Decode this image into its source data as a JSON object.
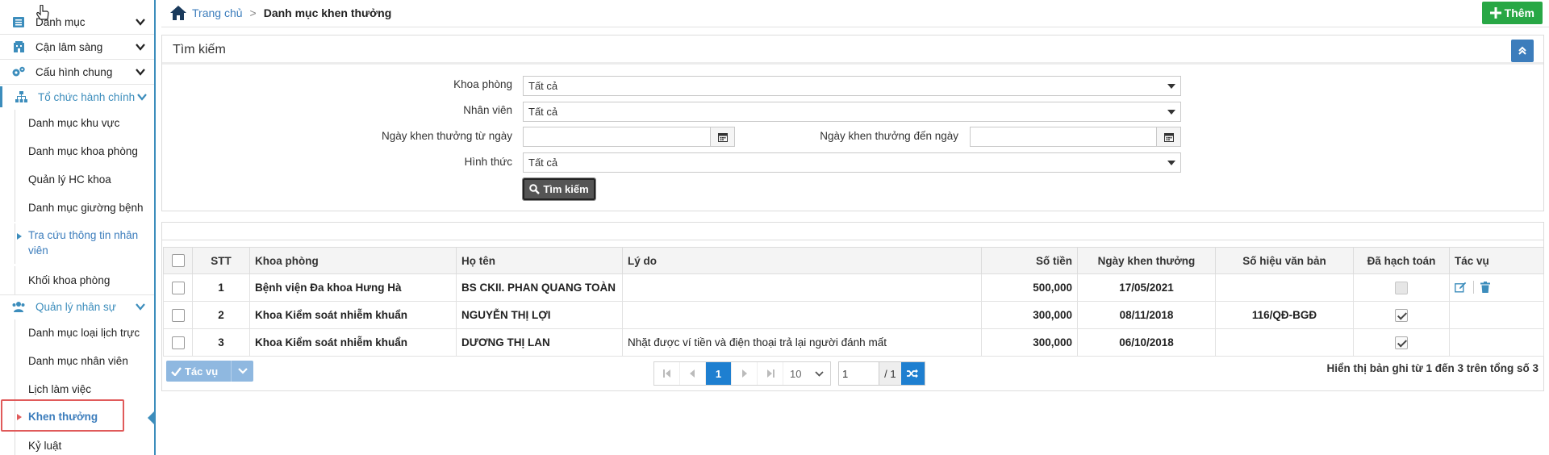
{
  "sidebar": {
    "items": [
      {
        "label": "Danh mục",
        "icon": "list-icon"
      },
      {
        "label": "Cận lâm sàng",
        "icon": "hospital-icon"
      },
      {
        "label": "Cấu hình chung",
        "icon": "gears-icon"
      },
      {
        "label": "Tổ chức hành chính",
        "icon": "org-chart-icon"
      }
    ],
    "org_sub": [
      "Danh mục khu vực",
      "Danh mục khoa phòng",
      "Quản lý HC khoa",
      "Danh mục giường bệnh",
      "Tra cứu thông tin nhân viên",
      "Khối khoa phòng"
    ],
    "hr_group": {
      "label": "Quản lý nhân sự",
      "icon": "users-icon"
    },
    "hr_sub": [
      "Danh mục loại lịch trực",
      "Danh mục nhân viên",
      "Lịch làm việc",
      "Khen thưởng",
      "Kỷ luật"
    ]
  },
  "header": {
    "home": "Trang chủ",
    "page": "Danh mục khen thưởng",
    "add_label": "Thêm"
  },
  "search": {
    "title": "Tìm kiếm",
    "dept_label": "Khoa phòng",
    "dept_value": "Tất cả",
    "staff_label": "Nhân viên",
    "staff_value": "Tất cả",
    "from_label": "Ngày khen thưởng từ ngày",
    "to_label": "Ngày khen thưởng đến ngày",
    "form_label": "Hình thức",
    "form_value": "Tất cả",
    "button": "Tìm kiếm"
  },
  "grid": {
    "headers": [
      "STT",
      "Khoa phòng",
      "Họ tên",
      "Lý do",
      "Số tiền",
      "Ngày khen thưởng",
      "Số hiệu văn bản",
      "Đã hạch toán",
      "Tác vụ"
    ],
    "rows": [
      {
        "stt": "1",
        "dept": "Bệnh viện Đa khoa Hưng Hà",
        "name": "BS CKII. PHAN QUANG TOÀN",
        "reason": "",
        "amount": "500,000",
        "date": "17/05/2021",
        "doc": "",
        "accounted": "disabled"
      },
      {
        "stt": "2",
        "dept": "Khoa Kiểm soát nhiễm khuẩn",
        "name": "NGUYỄN THỊ LỢI",
        "reason": "",
        "amount": "300,000",
        "date": "08/11/2018",
        "doc": "116/QĐ-BGĐ",
        "accounted": "checked"
      },
      {
        "stt": "3",
        "dept": "Khoa Kiểm soát nhiễm khuẩn",
        "name": "DƯƠNG THỊ LAN",
        "reason": "Nhặt được ví tiền và điện thoại trả lại người đánh mất",
        "amount": "300,000",
        "date": "06/10/2018",
        "doc": "",
        "accounted": "checked"
      }
    ]
  },
  "footer": {
    "action_label": "Tác vụ",
    "current_page": "1",
    "page_size": "10",
    "goto_value": "1",
    "total_pages": "/ 1",
    "record_info": "Hiển thị bản ghi từ 1 đến 3 trên tổng số 3"
  },
  "colors": {
    "accent": "#3c7dbc",
    "add_button": "#28a745",
    "active_outline": "#e05a5a",
    "pager_active": "#1e7fd0"
  }
}
